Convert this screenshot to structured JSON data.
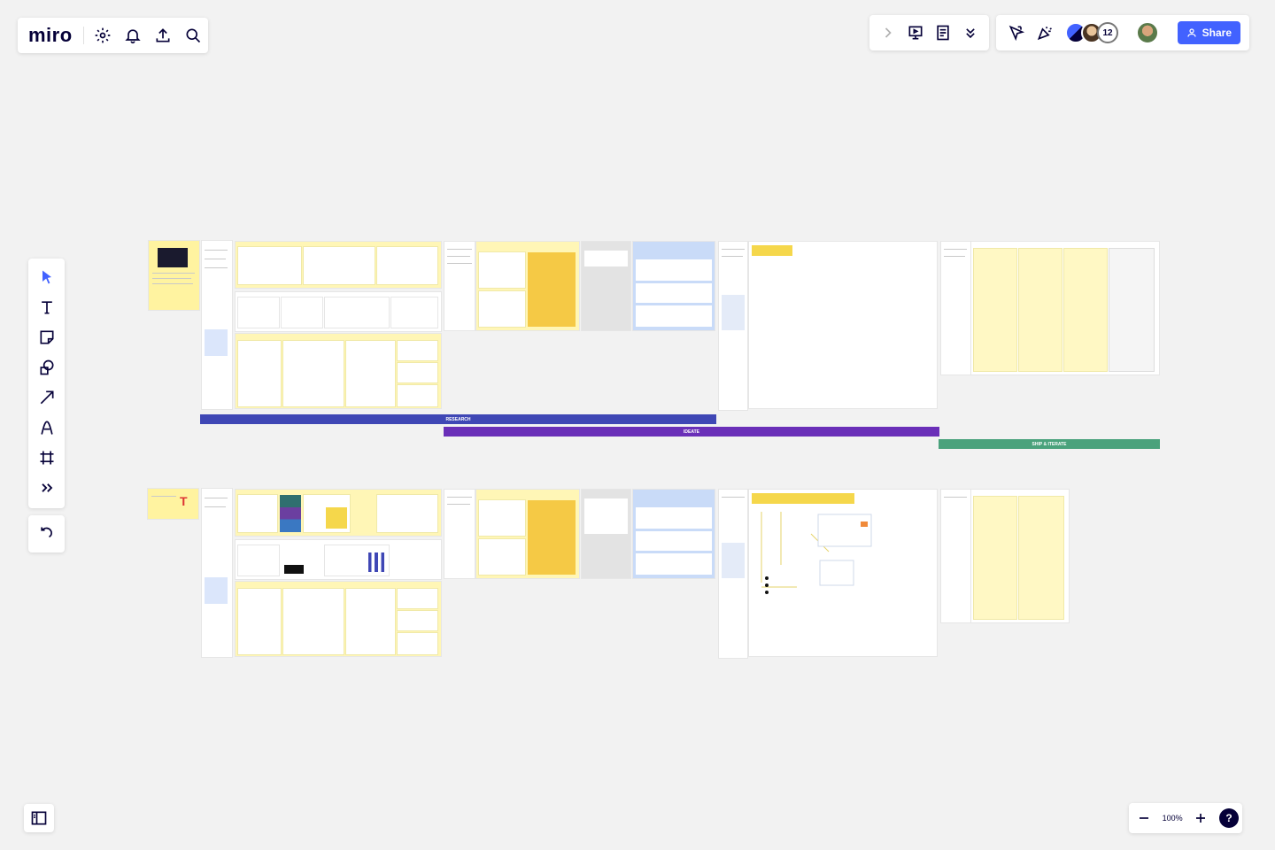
{
  "app": {
    "logo": "miro"
  },
  "collaborators": {
    "count": "12"
  },
  "share": {
    "label": "Share"
  },
  "zoom": {
    "level": "100%",
    "help": "?"
  },
  "phases": [
    {
      "label": "research",
      "color": "#3f47b5"
    },
    {
      "label": "ideate",
      "color": "#6a2fb8"
    },
    {
      "label": "ship & iterate",
      "color": "#4aa27c"
    }
  ],
  "icons": {
    "top_left": [
      "settings-icon",
      "bell-icon",
      "upload-icon",
      "search-icon"
    ],
    "top_right": [
      "chevron-right-icon",
      "presentation-icon",
      "notes-icon",
      "chevrons-down-icon",
      "cursor-follow-icon",
      "celebrate-icon"
    ],
    "toolbar": [
      "select-icon",
      "text-icon",
      "sticky-note-icon",
      "shapes-icon",
      "arrow-icon",
      "pen-icon",
      "frame-icon",
      "more-tools-icon"
    ]
  }
}
